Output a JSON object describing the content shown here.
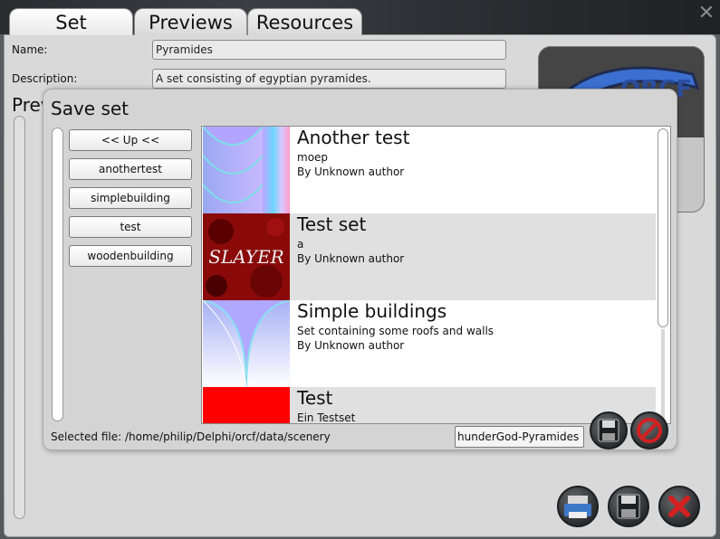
{
  "tabs": [
    "Set",
    "Previews",
    "Resources"
  ],
  "fields": {
    "name_label": "Name:",
    "name_value": "Pyramides",
    "description_label": "Description:",
    "description_value": "A set consisting of egyptian pyramides."
  },
  "preview_label": "Previ",
  "logo": {
    "text": "ORCF",
    "bottom_text": "R"
  },
  "dialog": {
    "title": "Save set",
    "dirs": [
      "<< Up <<",
      "anothertest",
      "simplebuilding",
      "test",
      "woodenbuilding"
    ],
    "items": [
      {
        "title": "Another test",
        "description": "moep",
        "author": "By Unknown author"
      },
      {
        "title": "Test set",
        "description": "a",
        "author": "By Unknown author",
        "thumb_text": "SLAYER"
      },
      {
        "title": "Simple buildings",
        "description": "Set containing some roofs and walls",
        "author": "By Unknown author"
      },
      {
        "title": "Test",
        "description": "Ein Testset",
        "author": ""
      }
    ],
    "selected_file": "Selected file: /home/philip/Delphi/orcf/data/scenery",
    "filename": "hunderGod-Pyramides"
  },
  "colors": {
    "accent_red": "#d32020",
    "panel_bg": "#d9d9d9",
    "dialog_bg": "#d4d4d4",
    "list_alt_row": "#e0e0e0"
  },
  "icons": {
    "save_dialog": "floppy-disk-icon",
    "cancel_dialog": "no-entry-icon",
    "print": "printer-icon",
    "save": "floppy-disk-icon",
    "close": "close-x-icon"
  }
}
